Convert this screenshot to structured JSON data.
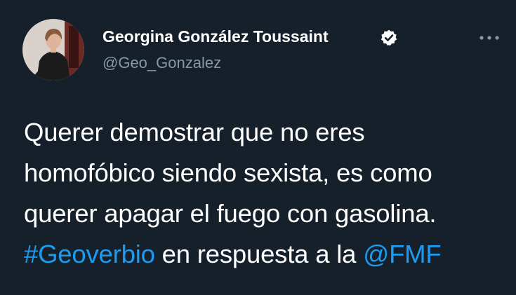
{
  "colors": {
    "background": "#15202b",
    "text": "#ffffff",
    "secondary_text": "#8899a6",
    "link": "#1d9bf0",
    "verified_badge": "#ffffff"
  },
  "author": {
    "name": "Georgina González Toussaint",
    "handle": "@Geo_Gonzalez",
    "verified": true,
    "avatar_icon": "profile-photo"
  },
  "more_icon": "more-horizontal-icon",
  "tweet": {
    "line1": "Querer demostrar que no eres",
    "line2": "homofóbico siendo sexista, es como",
    "line3": "querer apagar el fuego con gasolina.",
    "hashtag": "#Geoverbio",
    "line4_text": " en respuesta a la ",
    "mention": "@FMF"
  }
}
